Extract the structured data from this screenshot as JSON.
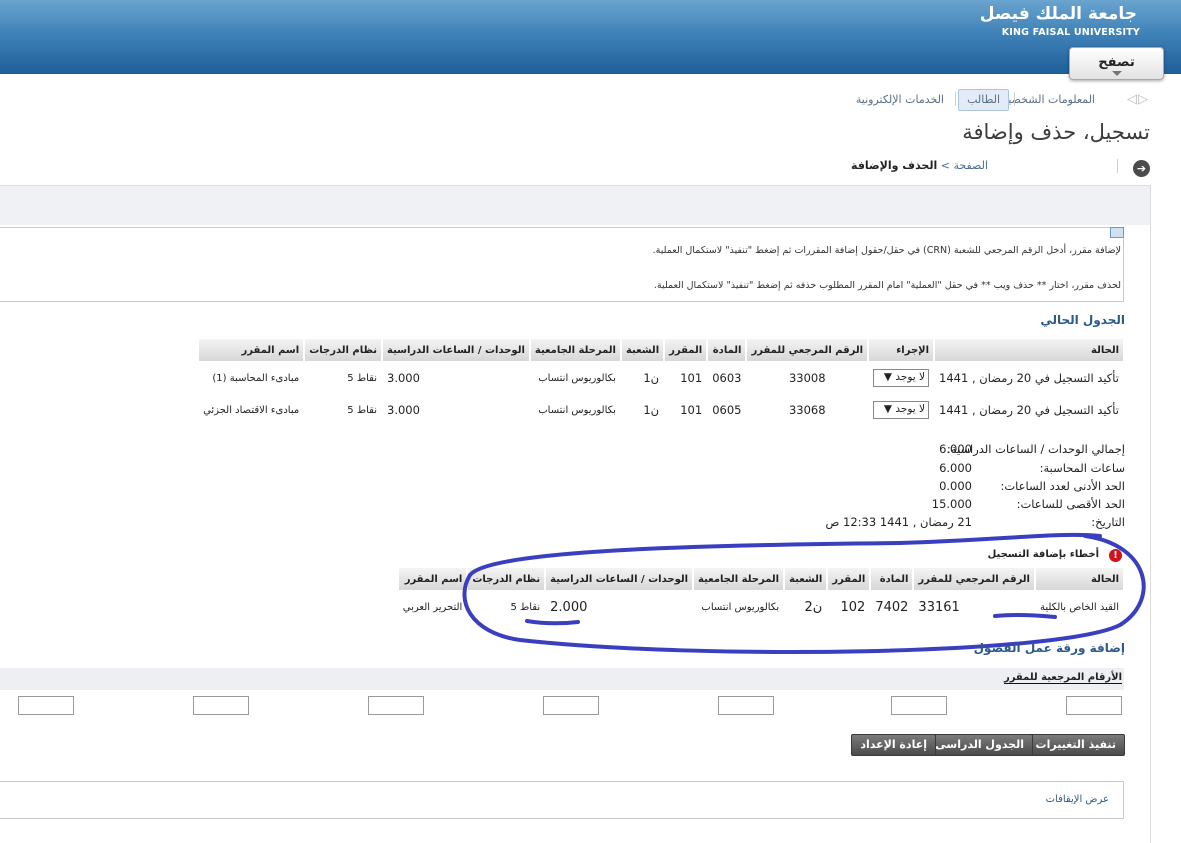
{
  "header": {
    "university_ar": "جامعة الملك فيصل",
    "university_en": "KING FAISAL UNIVERSITY",
    "browse_label": "تصفح"
  },
  "nav": {
    "tabs": [
      {
        "label": "المعلومات الشخصية",
        "active": false
      },
      {
        "label": "الطالب",
        "active": true
      },
      {
        "label": "الخدمات الإلكترونية",
        "active": false
      }
    ]
  },
  "page_title": "تسجيل، حذف وإضافة",
  "breadcrumb": {
    "home": "الصفحة",
    "separator": ">",
    "current": "الحذف والإضافة"
  },
  "info": {
    "line1": "لإضافة مقرر، أدخل الرقم المرجعي للشعبة (CRN) في حقل/حقول إضافة المقررات ثم إضغط \"تنفيذ\" لاستكمال العملية.",
    "line2": "لحذف مقرر، اختار ** حذف ويب ** في حقل \"العملية\" امام المقرر المطلوب حذفه ثم إضغط \"تنفيذ\" لاستكمال العملية."
  },
  "current_schedule": {
    "title": "الجدول الحالي",
    "headers": [
      "الحالة",
      "الإجراء",
      "الرقم المرجعي للمقرر",
      "المادة",
      "المقرر",
      "الشعبة",
      "المرحلة الجامعية",
      "الوحدات / الساعات الدراسية",
      "نظام الدرجات",
      "اسم المقرر"
    ],
    "rows": [
      {
        "status": "تأكيد التسجيل في 20 رمضان , 1441",
        "action": "لا يوجد",
        "crn": "33008",
        "subject": "0603",
        "course": "101",
        "section": "ن1",
        "level": "بكالوريوس انتساب",
        "credits": "3.000",
        "grading": "نقاط 5",
        "title": "مبادىء المحاسبة (1)"
      },
      {
        "status": "تأكيد التسجيل في 20 رمضان , 1441",
        "action": "لا يوجد",
        "crn": "33068",
        "subject": "0605",
        "course": "101",
        "section": "ن1",
        "level": "بكالوريوس انتساب",
        "credits": "3.000",
        "grading": "نقاط 5",
        "title": "مبادىء الاقتصاد الجزئي"
      }
    ]
  },
  "summary": [
    {
      "label": "إجمالي الوحدات / الساعات الدراسية:",
      "value": "6.000"
    },
    {
      "label": "ساعات المحاسبة:",
      "value": "6.000"
    },
    {
      "label": "الحد الأدنى لعدد الساعات:",
      "value": "0.000"
    },
    {
      "label": "الحد الأقصى للساعات:",
      "value": "15.000"
    },
    {
      "label": "التاريخ:",
      "value": "21 رمضان , 1441 12:33 ص"
    }
  ],
  "errors": {
    "title": "أخطاء بإضافة التسجيل",
    "headers": [
      "الحالة",
      "الرقم المرجعي للمقرر",
      "المادة",
      "المقرر",
      "الشعبة",
      "المرحلة الجامعية",
      "الوحدات / الساعات الدراسية",
      "نظام الدرجات",
      "اسم المقرر"
    ],
    "rows": [
      {
        "status": "القيد الخاص بالكلية",
        "crn": "33161",
        "subject": "7402",
        "course": "102",
        "section": "ن2",
        "level": "بكالوريوس انتساب",
        "credits": "2.000",
        "grading": "نقاط 5",
        "title": "التحرير العربي"
      }
    ]
  },
  "add_worksheet": {
    "title": "إضافة ورقة عمل الفصول",
    "crn_header": "الأرقام المرجعية للمقرر"
  },
  "buttons": {
    "submit": "تنفيذ التغييرات",
    "schedule": "الجدول الدراسى",
    "reset": "إعادة الإعداد"
  },
  "holds_link": "عرض الإيقافات",
  "colors": {
    "header_top": "#6aa4cf",
    "header_bottom": "#1f5f99",
    "link": "#2c5a8a",
    "error": "#d2131b",
    "annotation": "#3a3fbf"
  }
}
